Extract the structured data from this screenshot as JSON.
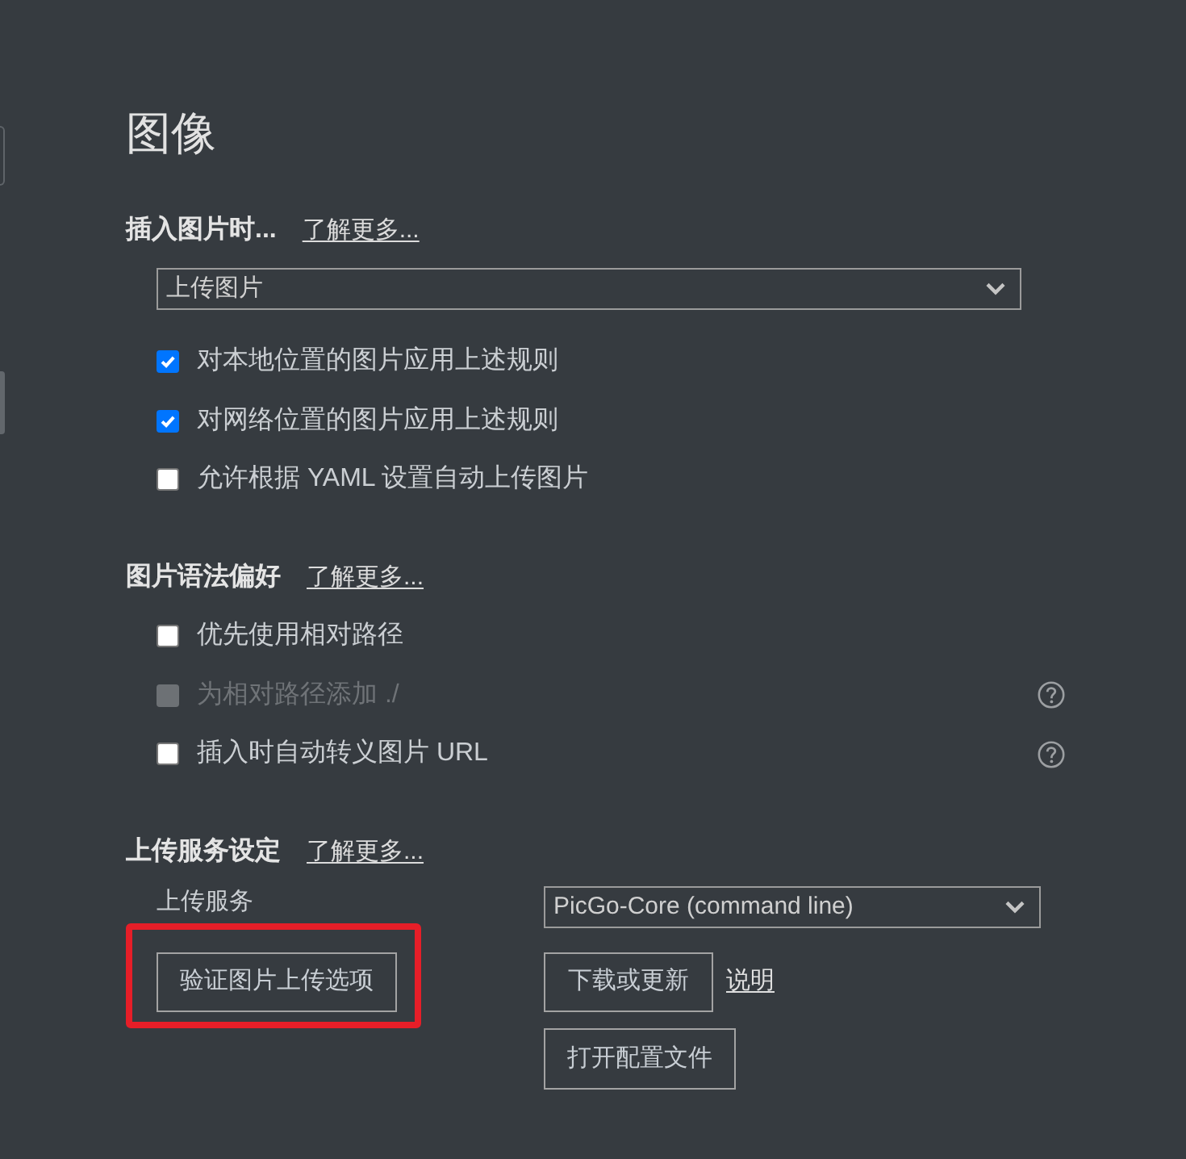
{
  "page": {
    "title": "图像"
  },
  "insert_section": {
    "heading": "插入图片时...",
    "link": "了解更多...",
    "action_select": {
      "value": "上传图片"
    },
    "options": [
      {
        "label": "对本地位置的图片应用上述规则",
        "checked": true,
        "disabled": false,
        "help": false
      },
      {
        "label": "对网络位置的图片应用上述规则",
        "checked": true,
        "disabled": false,
        "help": false
      },
      {
        "label": "允许根据 YAML 设置自动上传图片",
        "checked": false,
        "disabled": false,
        "help": false
      }
    ]
  },
  "syntax_section": {
    "heading": "图片语法偏好",
    "link": "了解更多...",
    "options": [
      {
        "label": "优先使用相对路径",
        "checked": false,
        "disabled": false,
        "help": false
      },
      {
        "label": "为相对路径添加 ./",
        "checked": false,
        "disabled": true,
        "help": true
      },
      {
        "label": "插入时自动转义图片 URL",
        "checked": false,
        "disabled": false,
        "help": true
      }
    ]
  },
  "upload_section": {
    "heading": "上传服务设定",
    "link": "了解更多...",
    "service_label": "上传服务",
    "service_select": {
      "value": "PicGo-Core (command line)"
    },
    "verify_button": {
      "label": "验证图片上传选项",
      "highlighted": true
    },
    "download_button": {
      "label": "下载或更新"
    },
    "docs_link": "说明",
    "open_config_button": {
      "label": "打开配置文件"
    }
  }
}
